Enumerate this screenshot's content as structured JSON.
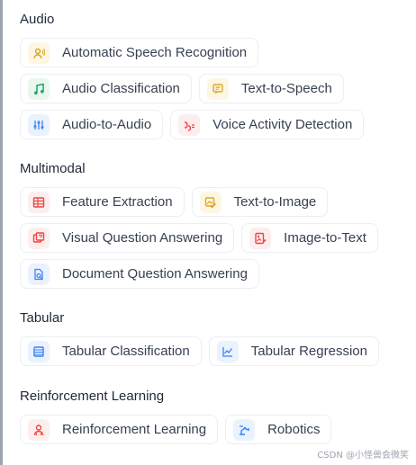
{
  "sections": [
    {
      "title": "Audio",
      "rows": [
        [
          {
            "label": "Automatic Speech Recognition",
            "icon": "microphone-user-icon",
            "icon_color": "#e0a51e",
            "icon_bg": "#fdf6e3"
          }
        ],
        [
          {
            "label": "Audio Classification",
            "icon": "music-note-icon",
            "icon_color": "#22a06b",
            "icon_bg": "#e9f7ef"
          },
          {
            "label": "Text-to-Speech",
            "icon": "speech-bubble-icon",
            "icon_color": "#e0a51e",
            "icon_bg": "#fdf6e3"
          }
        ],
        [
          {
            "label": "Audio-to-Audio",
            "icon": "sliders-icon",
            "icon_color": "#3b82f6",
            "icon_bg": "#eaf2fe"
          },
          {
            "label": "Voice Activity Detection",
            "icon": "voice-wave-icon",
            "icon_color": "#ef4444",
            "icon_bg": "#fdeeee"
          }
        ]
      ]
    },
    {
      "title": "Multimodal",
      "rows": [
        [
          {
            "label": "Feature Extraction",
            "icon": "table-grid-icon",
            "icon_color": "#ef4444",
            "icon_bg": "#fdeeee"
          },
          {
            "label": "Text-to-Image",
            "icon": "image-pencil-icon",
            "icon_color": "#e0a51e",
            "icon_bg": "#fdf6e3"
          }
        ],
        [
          {
            "label": "Visual Question Answering",
            "icon": "image-question-icon",
            "icon_color": "#ef4444",
            "icon_bg": "#fdeeee"
          },
          {
            "label": "Image-to-Text",
            "icon": "image-text-icon",
            "icon_color": "#ef4444",
            "icon_bg": "#fdeeee"
          }
        ],
        [
          {
            "label": "Document Question Answering",
            "icon": "document-search-icon",
            "icon_color": "#3b82f6",
            "icon_bg": "#eaf2fe"
          }
        ]
      ]
    },
    {
      "title": "Tabular",
      "rows": [
        [
          {
            "label": "Tabular Classification",
            "icon": "table-list-icon",
            "icon_color": "#3b82f6",
            "icon_bg": "#eaf2fe"
          },
          {
            "label": "Tabular Regression",
            "icon": "line-chart-icon",
            "icon_color": "#3b82f6",
            "icon_bg": "#eaf2fe"
          }
        ]
      ]
    },
    {
      "title": "Reinforcement Learning",
      "rows": [
        [
          {
            "label": "Reinforcement Learning",
            "icon": "robot-user-icon",
            "icon_color": "#ef4444",
            "icon_bg": "#fdeeee"
          },
          {
            "label": "Robotics",
            "icon": "robot-arm-icon",
            "icon_color": "#3b82f6",
            "icon_bg": "#eaf2fe"
          }
        ]
      ]
    }
  ],
  "watermark": "CSDN @小怪兽会微笑"
}
